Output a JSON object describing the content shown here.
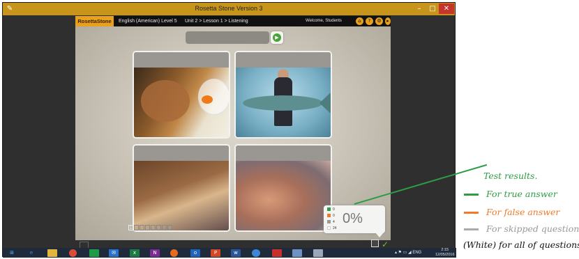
{
  "window": {
    "title": "Rosetta Stone Version 3",
    "app_icon": "app-icon",
    "controls": {
      "minimize": "–",
      "maximize": "□",
      "close": "✕"
    }
  },
  "header": {
    "logo": "RosettaStone",
    "course": "English (American) Level 5",
    "breadcrumb": "Unit 2 > Lesson 1 > Listening",
    "welcome": "Welcome, Students",
    "icons": [
      "home-icon",
      "help-icon",
      "settings-icon",
      "exit-icon"
    ],
    "accent_color": "#e8a01d"
  },
  "prompt": {
    "play_icon": "play-audio-icon"
  },
  "cards": [
    {
      "subject": "cat-and-goldfish"
    },
    {
      "subject": "man-holding-fish"
    },
    {
      "subject": "woman-and-child"
    },
    {
      "subject": "child-eating"
    }
  ],
  "pager": {
    "pages": [
      "1",
      "2",
      "3",
      "4",
      "5",
      "6",
      "7",
      "8"
    ],
    "current": "1"
  },
  "results": {
    "rows": [
      {
        "kind": "true",
        "color": "#2f9c45",
        "count": "0"
      },
      {
        "kind": "false",
        "color": "#f07a2a",
        "count": "0"
      },
      {
        "kind": "skipped",
        "color": "#999999",
        "count": "4"
      },
      {
        "kind": "all",
        "color": "#ffffff",
        "count": "24"
      }
    ],
    "percent": "0%"
  },
  "taskbar": {
    "apps": [
      "windows-start-icon",
      "internet-explorer-icon",
      "file-explorer-icon",
      "chrome-icon",
      "store-icon",
      "mail-icon",
      "excel-icon",
      "onenote-icon",
      "firefox-icon",
      "outlook-icon",
      "powerpoint-icon",
      "word-icon",
      "app-icon",
      "acrobat-icon",
      "rosetta-stone-icon",
      "tablet-icon"
    ],
    "tray_text": "ENG",
    "clock_time": "2:15",
    "clock_date": "12/05/2016"
  },
  "annotations": {
    "title": "Test results.",
    "true_answer": "For true answer",
    "false_answer": "For false answer",
    "skipped": "For skipped questions",
    "all": "(White) for all of questions",
    "colors": {
      "true": "#2f9c45",
      "false": "#f07a2a",
      "skipped": "#999999"
    }
  }
}
